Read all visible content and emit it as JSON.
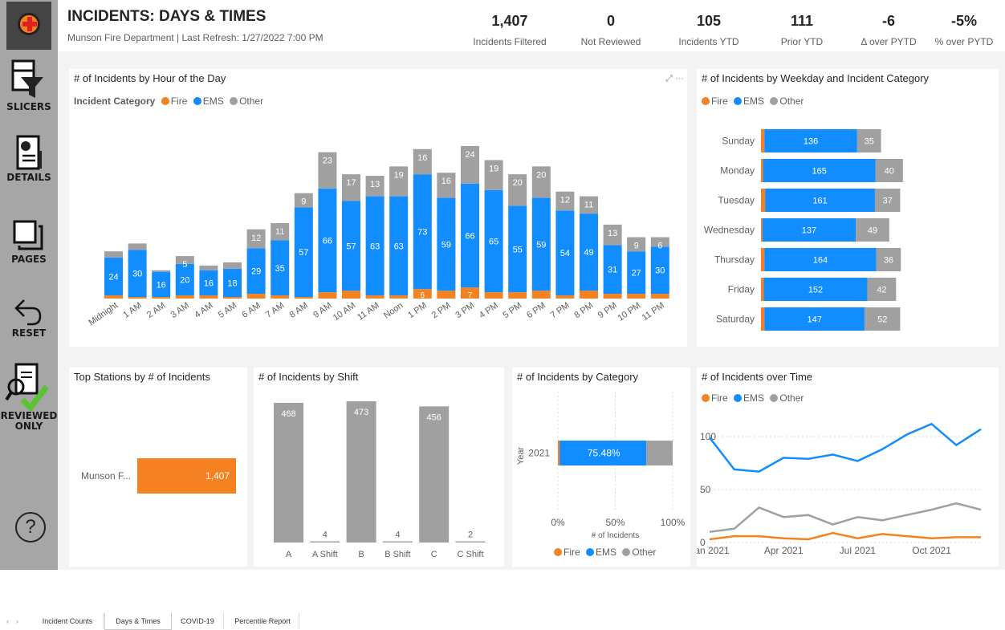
{
  "header": {
    "title": "INCIDENTS: DAYS & TIMES",
    "subtitle": "Munson Fire Department | Last Refresh: 1/27/2022 7:00 PM",
    "kpis": [
      {
        "value": "1,407",
        "label": "Incidents Filtered"
      },
      {
        "value": "0",
        "label": "Not Reviewed"
      },
      {
        "value": "105",
        "label": "Incidents YTD"
      },
      {
        "value": "111",
        "label": "Prior YTD"
      },
      {
        "value": "-6",
        "label": "Δ over PYTD"
      },
      {
        "value": "-5%",
        "label": "% over PYTD"
      }
    ]
  },
  "sidebar": {
    "slicers": "SLICERS",
    "details": "DETAILS",
    "pages": "PAGES",
    "reset": "RESET",
    "reviewed_1": "REVIEWED",
    "reviewed_2": "ONLY",
    "help": "?"
  },
  "colors": {
    "fire": "#f58220",
    "ems": "#118dff",
    "other": "#a0a0a0"
  },
  "legend_labels": {
    "title": "Incident Category",
    "fire": "Fire",
    "ems": "EMS",
    "other": "Other"
  },
  "tabs": [
    "Incident Counts",
    "Days & Times",
    "COVID-19",
    "Percentile Report"
  ],
  "chart_data": [
    {
      "type": "bar",
      "title": "# of Incidents by Hour of the Day",
      "stacked": true,
      "categories": [
        "Midnight",
        "1 AM",
        "2 AM",
        "3 AM",
        "4 AM",
        "5 AM",
        "6 AM",
        "7 AM",
        "8 AM",
        "9 AM",
        "10 AM",
        "11 AM",
        "Noon",
        "1 PM",
        "2 PM",
        "3 PM",
        "4 PM",
        "5 PM",
        "6 PM",
        "7 PM",
        "8 PM",
        "9 PM",
        "10 PM",
        "11 PM"
      ],
      "series": [
        {
          "name": "Fire",
          "values": [
            2,
            1,
            1,
            2,
            2,
            1,
            3,
            2,
            1,
            4,
            5,
            2,
            2,
            6,
            5,
            7,
            4,
            4,
            5,
            2,
            5,
            3,
            3,
            3
          ]
        },
        {
          "name": "EMS",
          "values": [
            24,
            30,
            16,
            20,
            16,
            18,
            29,
            35,
            57,
            66,
            57,
            63,
            63,
            73,
            59,
            66,
            65,
            55,
            59,
            54,
            49,
            31,
            27,
            30
          ]
        },
        {
          "name": "Other",
          "values": [
            4,
            4,
            1,
            5,
            3,
            4,
            12,
            11,
            9,
            23,
            17,
            13,
            19,
            16,
            16,
            24,
            19,
            20,
            20,
            12,
            11,
            13,
            9,
            6
          ]
        }
      ],
      "legend": "top-left"
    },
    {
      "type": "bar",
      "title": "# of Incidents by Weekday and Incident Category",
      "orientation": "horizontal",
      "stacked": true,
      "categories": [
        "Sunday",
        "Monday",
        "Tuesday",
        "Wednesday",
        "Thursday",
        "Friday",
        "Saturday"
      ],
      "series": [
        {
          "name": "Fire",
          "values": [
            5,
            3,
            6,
            2,
            5,
            4,
            5
          ]
        },
        {
          "name": "EMS",
          "values": [
            136,
            165,
            161,
            137,
            164,
            152,
            147
          ]
        },
        {
          "name": "Other",
          "values": [
            35,
            40,
            37,
            49,
            36,
            42,
            52
          ]
        }
      ]
    },
    {
      "type": "bar",
      "title": "Top Stations by # of Incidents",
      "orientation": "horizontal",
      "categories": [
        "Munson F..."
      ],
      "values": [
        1407
      ],
      "value_labels": [
        "1,407"
      ]
    },
    {
      "type": "bar",
      "title": "# of Incidents by Shift",
      "categories": [
        "A",
        "A Shift",
        "B",
        "B Shift",
        "C",
        "C Shift"
      ],
      "values": [
        468,
        4,
        473,
        4,
        456,
        2
      ]
    },
    {
      "type": "bar",
      "title": "# of Incidents by Category",
      "orientation": "horizontal",
      "stacked_percent": true,
      "categories": [
        "2021"
      ],
      "ylabel": "Year",
      "xlabel": "# of Incidents",
      "series": [
        {
          "name": "Fire",
          "values": [
            1.5
          ]
        },
        {
          "name": "EMS",
          "values": [
            75.48
          ]
        },
        {
          "name": "Other",
          "values": [
            23.02
          ]
        }
      ],
      "data_label": "75.48%",
      "xticks": [
        "0%",
        "50%",
        "100%"
      ]
    },
    {
      "type": "line",
      "title": "# of Incidents over Time",
      "x": [
        "2021-01",
        "2021-02",
        "2021-03",
        "2021-04",
        "2021-05",
        "2021-06",
        "2021-07",
        "2021-08",
        "2021-09",
        "2021-10",
        "2021-11",
        "2021-12"
      ],
      "series": [
        {
          "name": "Fire",
          "values": [
            3,
            6,
            6,
            4,
            3,
            9,
            4,
            8,
            6,
            4,
            5,
            5
          ]
        },
        {
          "name": "EMS",
          "values": [
            99,
            69,
            67,
            80,
            79,
            83,
            77,
            88,
            102,
            112,
            92,
            107
          ]
        },
        {
          "name": "Other",
          "values": [
            10,
            13,
            33,
            24,
            26,
            17,
            24,
            21,
            26,
            31,
            37,
            31
          ]
        }
      ],
      "xticks": [
        "Jan 2021",
        "Apr 2021",
        "Jul 2021",
        "Oct 2021"
      ],
      "yticks": [
        "0",
        "50",
        "100"
      ],
      "ylim": [
        0,
        120
      ]
    }
  ]
}
